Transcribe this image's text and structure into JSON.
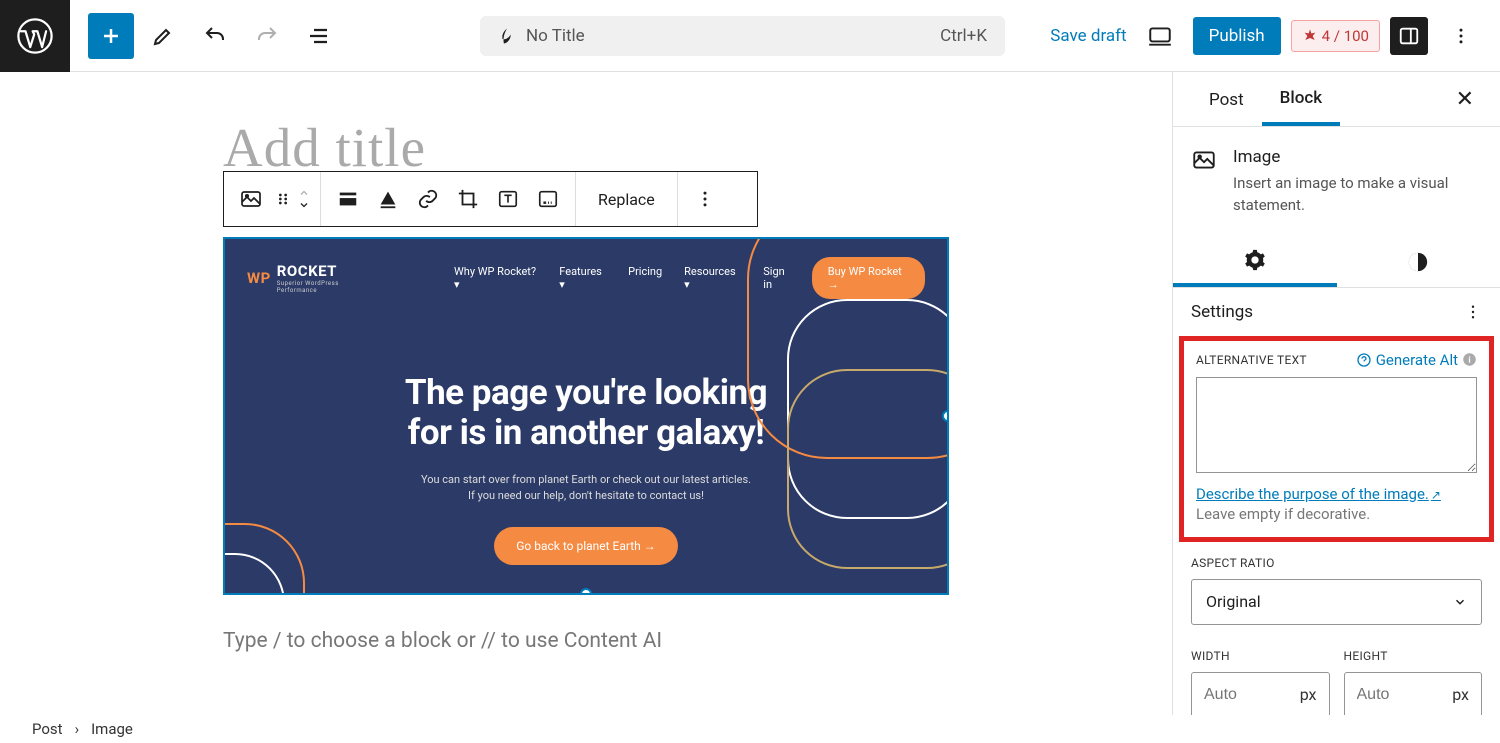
{
  "topbar": {
    "no_title": "No Title",
    "shortcut": "Ctrl+K",
    "save_draft": "Save draft",
    "publish": "Publish",
    "score": "4 / 100"
  },
  "canvas": {
    "title_placeholder": "Add title",
    "block_toolbar": {
      "replace": "Replace"
    },
    "block_prompt": "Type / to choose a block or // to use Content AI"
  },
  "image_content": {
    "logo": "ROCKET",
    "logo_prefix": "WP",
    "logo_sub": "Superior WordPress Performance",
    "nav": [
      "Why WP Rocket? ▾",
      "Features ▾",
      "Pricing",
      "Resources ▾"
    ],
    "signin": "Sign in",
    "buy": "Buy WP Rocket  →",
    "hero_line1": "The page you're looking",
    "hero_line2": "for is in another galaxy!",
    "sub1": "You can start over from planet Earth or check out our latest articles.",
    "sub2": "If you need our help, don't hesitate to contact us!",
    "cta": "Go back to planet Earth   →"
  },
  "sidebar": {
    "tabs": {
      "post": "Post",
      "block": "Block"
    },
    "block": {
      "name": "Image",
      "desc": "Insert an image to make a visual statement."
    },
    "settings_header": "Settings",
    "alt": {
      "label": "ALTERNATIVE TEXT",
      "generate": "Generate Alt",
      "link": "Describe the purpose of the image.",
      "help": "Leave empty if decorative."
    },
    "aspect": {
      "label": "ASPECT RATIO",
      "value": "Original"
    },
    "width": {
      "label": "WIDTH",
      "placeholder": "Auto",
      "unit": "px"
    },
    "height": {
      "label": "HEIGHT",
      "placeholder": "Auto",
      "unit": "px"
    }
  },
  "breadcrumb": {
    "root": "Post",
    "current": "Image"
  }
}
